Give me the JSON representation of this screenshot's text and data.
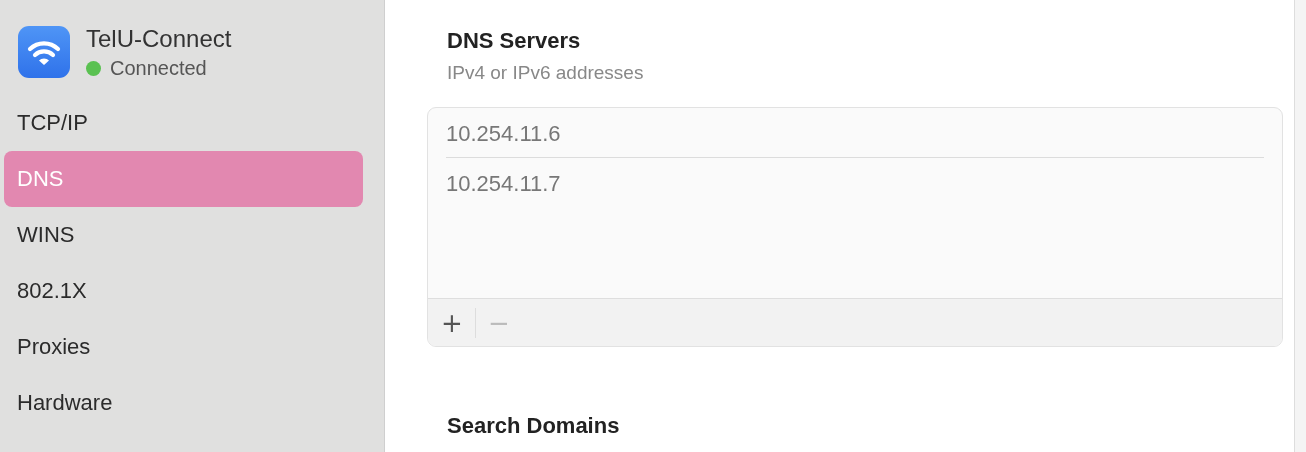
{
  "network": {
    "name": "TelU-Connect",
    "status": "Connected",
    "connected": true
  },
  "sidebar": {
    "items": [
      {
        "label": "TCP/IP",
        "selected": false
      },
      {
        "label": "DNS",
        "selected": true
      },
      {
        "label": "WINS",
        "selected": false
      },
      {
        "label": "802.1X",
        "selected": false
      },
      {
        "label": "Proxies",
        "selected": false
      },
      {
        "label": "Hardware",
        "selected": false
      }
    ]
  },
  "dns_servers": {
    "title": "DNS Servers",
    "subtitle": "IPv4 or IPv6 addresses",
    "entries": [
      "10.254.11.6",
      "10.254.11.7"
    ],
    "buttons": [
      {
        "label": "+",
        "disabled": false
      },
      {
        "label": "−",
        "disabled": true
      }
    ]
  },
  "search_domains": {
    "title": "Search Domains"
  }
}
